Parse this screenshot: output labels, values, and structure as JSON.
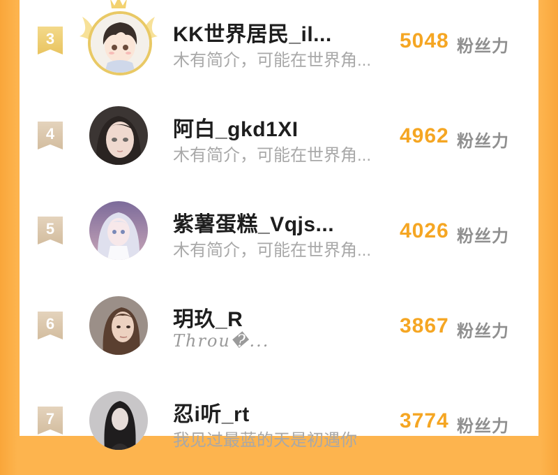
{
  "leaderboard": {
    "entries": [
      {
        "rank": "3",
        "name": "KK世界居民_il...",
        "bio": "木有简介，可能在世界角...",
        "score": "5048",
        "unit": "粉丝力",
        "avatar_icon": "anime-boy-avatar",
        "frame": "gold-wings-frame"
      },
      {
        "rank": "4",
        "name": "阿白_gkd1XI",
        "bio": "木有简介，可能在世界角...",
        "score": "4962",
        "unit": "粉丝力",
        "avatar_icon": "anime-girl-dark-hair-avatar"
      },
      {
        "rank": "5",
        "name": "紫薯蛋糕_Vqjs...",
        "bio": "木有简介，可能在世界角...",
        "score": "4026",
        "unit": "粉丝力",
        "avatar_icon": "anime-girl-silver-hair-avatar"
      },
      {
        "rank": "6",
        "name": "玥玖_R",
        "bio": "Throu�...",
        "score": "3867",
        "unit": "粉丝力",
        "avatar_icon": "photo-woman-avatar"
      },
      {
        "rank": "7",
        "name": "忍i听_rt",
        "bio": "我见过最蓝的天是初遇你",
        "score": "3774",
        "unit": "粉丝力",
        "avatar_icon": "photo-dark-hair-avatar"
      }
    ]
  },
  "colors": {
    "accent": "#f5a623",
    "frame_orange": "#fdb44e",
    "badge": "#d8c3a5",
    "badge_gold": "#ecc868"
  }
}
